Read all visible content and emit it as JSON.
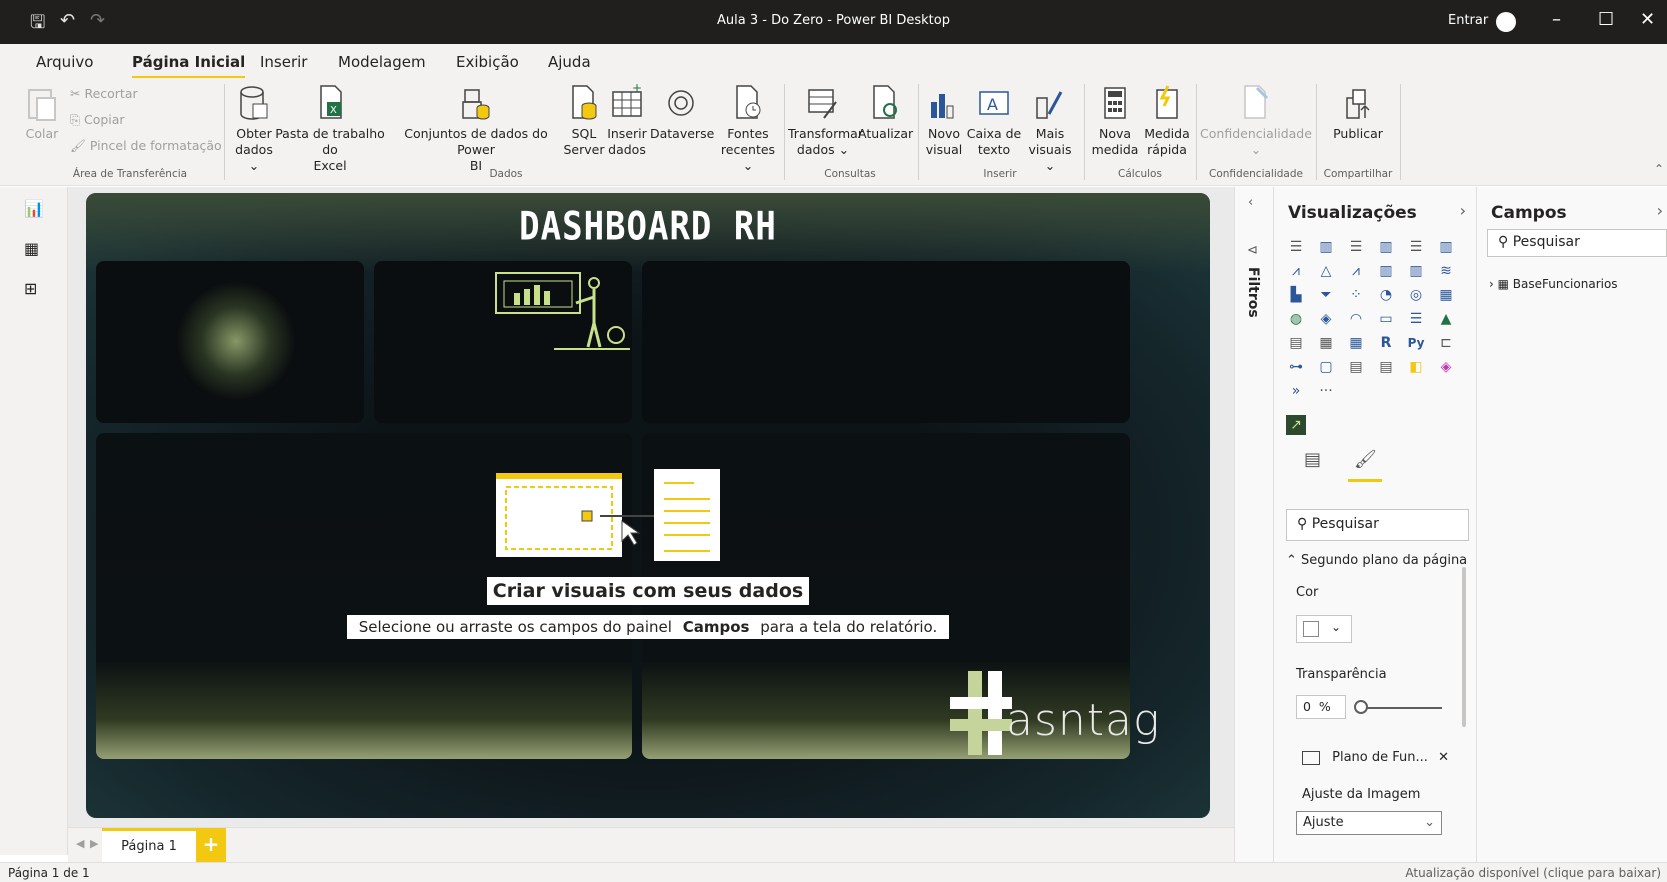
{
  "window": {
    "title": "Aula 3 - Do Zero - Power BI Desktop",
    "signin": "Entrar",
    "minimize": "–",
    "maximize": "☐",
    "close": "✕"
  },
  "ribbon_tabs": [
    "Arquivo",
    "Página Inicial",
    "Inserir",
    "Modelagem",
    "Exibição",
    "Ajuda"
  ],
  "ribbon": {
    "clipboard": {
      "paste": "Colar",
      "cut": "Recortar",
      "copy": "Copiar",
      "format_painter": "Pincel de formatação",
      "group": "Área de Transferência"
    },
    "data": {
      "get_data_l1": "Obter",
      "get_data_l2": "dados",
      "excel_l1": "Pasta de trabalho do",
      "excel_l2": "Excel",
      "datasets_l1": "Conjuntos de dados do Power",
      "datasets_l2": "BI",
      "sql_l1": "SQL",
      "sql_l2": "Server",
      "enter_l1": "Inserir",
      "enter_l2": "dados",
      "dataverse": "Dataverse",
      "recent_l1": "Fontes",
      "recent_l2": "recentes",
      "group": "Dados"
    },
    "queries": {
      "transform_l1": "Transformar",
      "transform_l2": "dados",
      "refresh": "Atualizar",
      "group": "Consultas"
    },
    "insert": {
      "new_visual_l1": "Novo",
      "new_visual_l2": "visual",
      "textbox_l1": "Caixa de",
      "textbox_l2": "texto",
      "more_l1": "Mais",
      "more_l2": "visuais",
      "group": "Inserir"
    },
    "calc": {
      "new_measure_l1": "Nova",
      "new_measure_l2": "medida",
      "quick_l1": "Medida",
      "quick_l2": "rápida",
      "group": "Cálculos"
    },
    "sensitivity": {
      "label": "Confidencialidade",
      "group": "Confidencialidade"
    },
    "share": {
      "publish": "Publicar",
      "group": "Compartilhar"
    }
  },
  "canvas": {
    "dashboard_title": "DASHBOARD RH",
    "create_title": "Criar visuais com seus dados",
    "create_sub_pre": "Selecione ou arraste os campos do painel ",
    "create_sub_bold": "Campos",
    "create_sub_post": " para a tela do relatório.",
    "logo_text": "asntag"
  },
  "page_tabs": {
    "page1": "Página 1",
    "add": "+"
  },
  "status": {
    "page": "Página 1 de 1",
    "update": "Atualização disponível (clique para baixar)"
  },
  "filters": {
    "label": "Filtros"
  },
  "visualizations": {
    "title": "Visualizações",
    "search_placeholder": "Pesquisar",
    "section": "Segundo plano da página",
    "color_label": "Cor",
    "transparency_label": "Transparência",
    "transparency_value": "0",
    "percent": "%",
    "image_name": "Plano de Fun...",
    "image_fit_label": "Ajuste da Imagem",
    "image_fit_value": "Ajuste",
    "more": "···"
  },
  "fields": {
    "title": "Campos",
    "search_placeholder": "Pesquisar",
    "table": "BaseFuncionarios"
  },
  "colors": {
    "accent": "#f2c811",
    "titlebar": "#201f1e",
    "canvas_bg": "#0d1418"
  }
}
